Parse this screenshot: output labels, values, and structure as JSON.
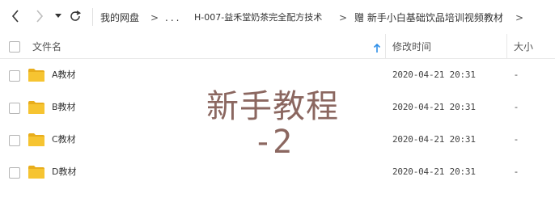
{
  "toolbar": {
    "breadcrumb": [
      "我的网盘",
      "...",
      "H-007-益禾堂奶茶完全配方技术",
      "赠 新手小白基础饮品培训视频教材"
    ],
    "separator": ">"
  },
  "columns": {
    "name": "文件名",
    "modified": "修改时间",
    "size": "大小"
  },
  "files": [
    {
      "name": "A教材",
      "modified": "2020-04-21 20:31",
      "size": "-"
    },
    {
      "name": "B教材",
      "modified": "2020-04-21 20:31",
      "size": "-"
    },
    {
      "name": "C教材",
      "modified": "2020-04-21 20:31",
      "size": "-"
    },
    {
      "name": "D教材",
      "modified": "2020-04-21 20:31",
      "size": "-"
    }
  ],
  "watermark": {
    "line1": "新手教程",
    "line2": "-2"
  },
  "colors": {
    "folder": "#f6c431",
    "folder_tab": "#e8ad1c",
    "sort_arrow": "#2f8fe8",
    "watermark": "#8b6760"
  },
  "icons": [
    "back-icon",
    "forward-icon",
    "dropdown-icon",
    "refresh-icon",
    "folder-icon",
    "sort-up-icon"
  ]
}
